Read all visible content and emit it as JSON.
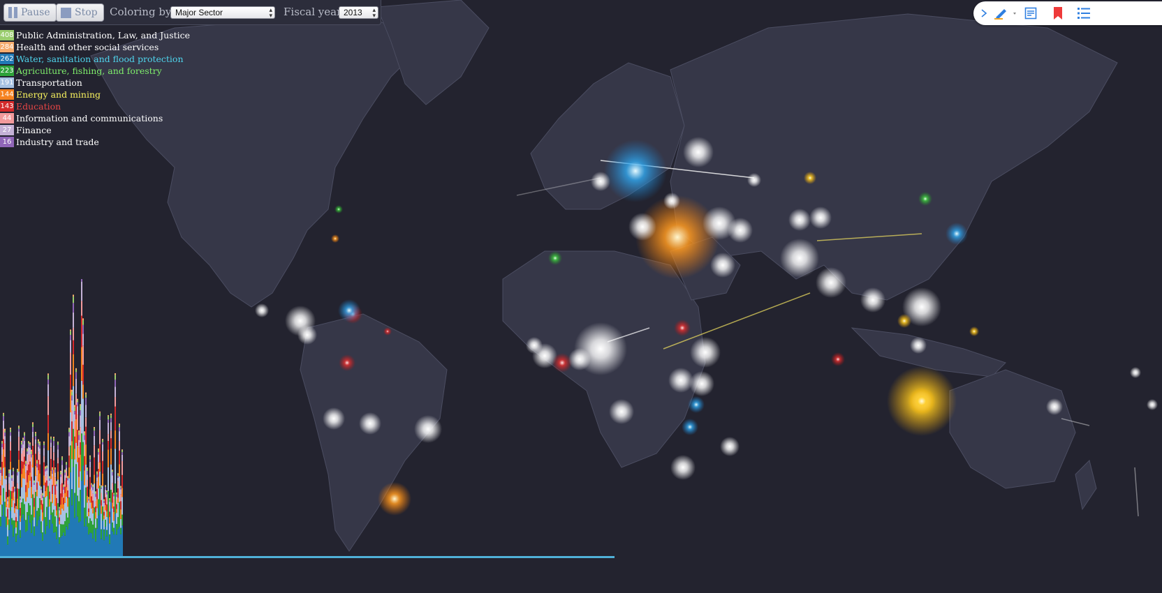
{
  "controls": {
    "pause_label": "Pause",
    "stop_label": "Stop",
    "coloring_label": "Coloring by:",
    "coloring_value": "Major Sector",
    "year_label": "Fiscal year:",
    "year_value": "2013"
  },
  "legend": [
    {
      "count": "408",
      "label": "Public Administration, Law, and Justice",
      "color": "#9acd6e",
      "text_color": "#ffffff"
    },
    {
      "count": "284",
      "label": "Health and other social services",
      "color": "#f5ac6e",
      "text_color": "#ffffff"
    },
    {
      "count": "262",
      "label": "Water, sanitation and flood protection",
      "color": "#2179b6",
      "text_color": "#4fd4ec"
    },
    {
      "count": "223",
      "label": "Agriculture, fishing, and forestry",
      "color": "#2ea23a",
      "text_color": "#7fee6c"
    },
    {
      "count": "191",
      "label": "Transportation",
      "color": "#a7c2e2",
      "text_color": "#ffffff"
    },
    {
      "count": "144",
      "label": "Energy and mining",
      "color": "#f58220",
      "text_color": "#f8f25e"
    },
    {
      "count": "143",
      "label": "Education",
      "color": "#d42a2b",
      "text_color": "#e84545"
    },
    {
      "count": "44",
      "label": "Information and communications",
      "color": "#f29a9c",
      "text_color": "#ffffff"
    },
    {
      "count": "27",
      "label": "Finance",
      "color": "#c4b1d6",
      "text_color": "#ffffff"
    },
    {
      "count": "16",
      "label": "Industry and trade",
      "color": "#9066b8",
      "text_color": "#ffffff"
    }
  ],
  "toolbar": {
    "icons": [
      "collapse-chevron-icon",
      "highlighter-icon",
      "notes-icon",
      "bookmark-icon",
      "list-icon"
    ],
    "accent": "#2f7fe0",
    "bookmark_color": "#ee3a3a"
  },
  "map_colors": {
    "background": "#23232f",
    "land": "#363748",
    "border": "#4b4d61"
  }
}
